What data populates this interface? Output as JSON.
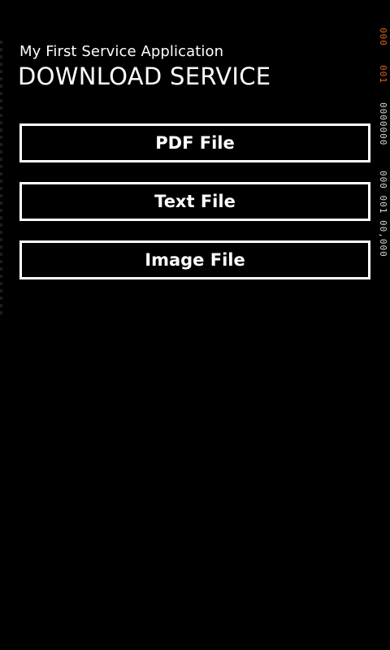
{
  "header": {
    "app_title": "My First Service Application",
    "page_title": "DOWNLOAD SERVICE"
  },
  "buttons": [
    {
      "label": "PDF File"
    },
    {
      "label": "Text File"
    },
    {
      "label": "Image File"
    }
  ],
  "debug_counters": [
    {
      "text": "000",
      "color": "#e2681c"
    },
    {
      "text": "001",
      "color": "#e2681c"
    },
    {
      "text": "0000000",
      "color": "#d8d8d8"
    },
    {
      "text": "000 001 00,000",
      "color": "#d8d8d8"
    }
  ]
}
